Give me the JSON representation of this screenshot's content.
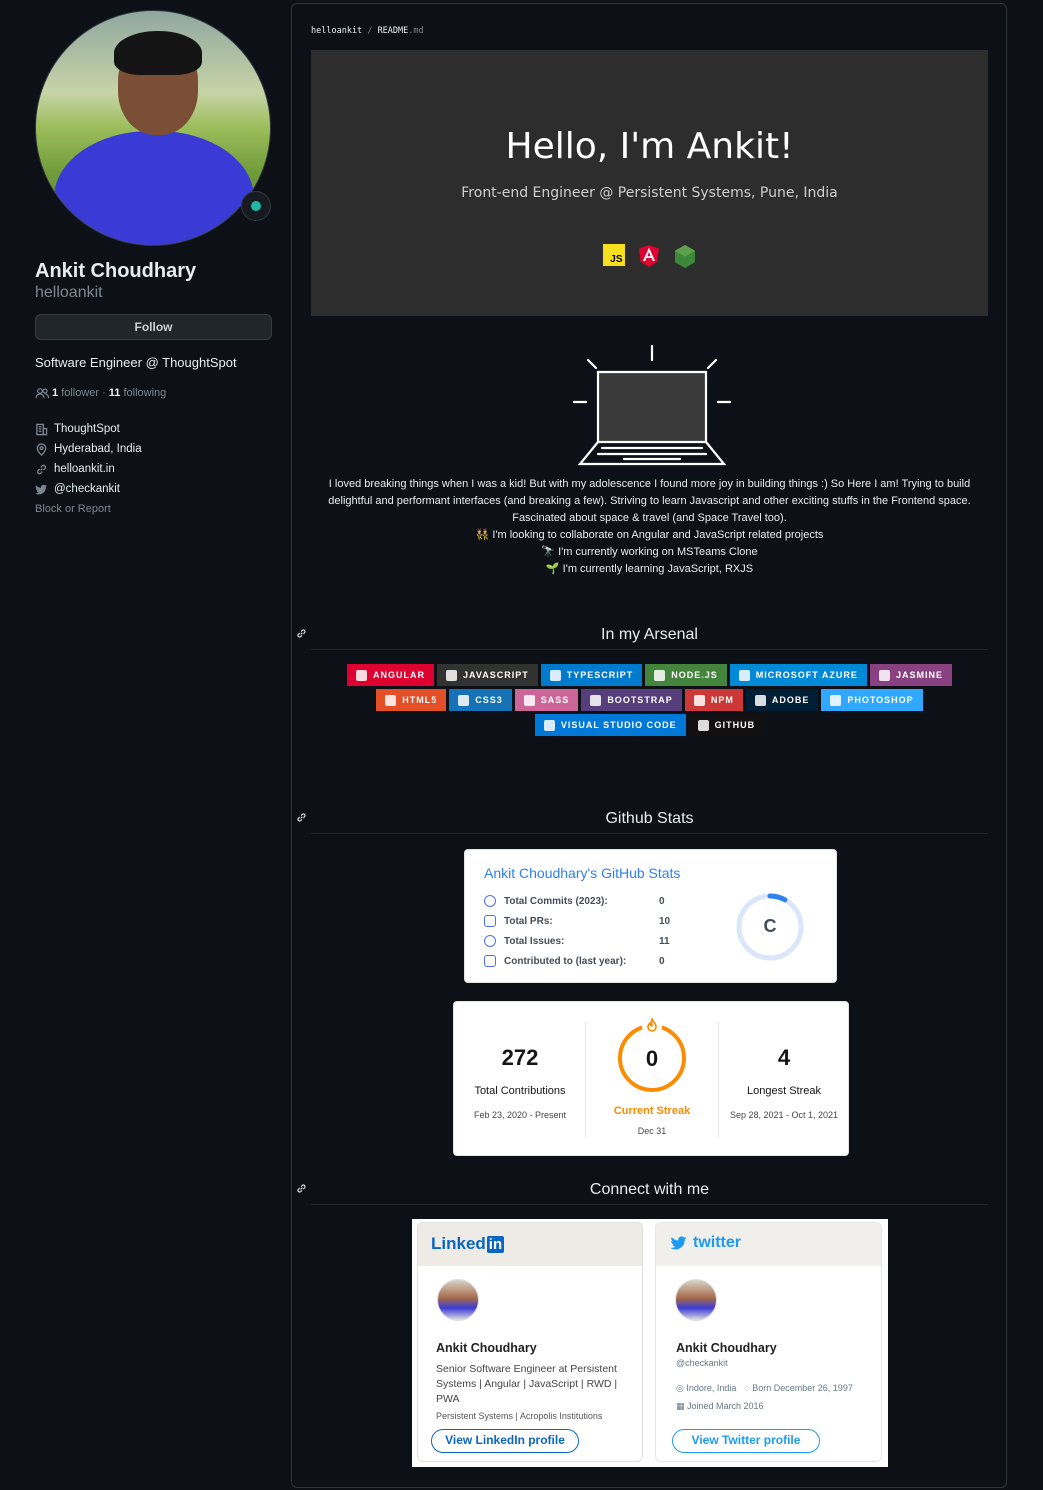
{
  "profile": {
    "name": "Ankit Choudhary",
    "login": "helloankit",
    "follow_label": "Follow",
    "bio": "Software Engineer @ ThoughtSpot",
    "followers_count": "1",
    "followers_label": "follower",
    "separator": "·",
    "following_count": "11",
    "following_label": "following",
    "company": "ThoughtSpot",
    "location": "Hyderabad, India",
    "website": "helloankit.in",
    "twitter": "@checkankit",
    "block_report": "Block or Report"
  },
  "breadcrumb": {
    "repo": "helloankit",
    "sep": "/",
    "file": "README",
    "ext": ".md"
  },
  "hero": {
    "title": "Hello, I'm Ankit!",
    "subtitle": "Front-end Engineer @ Persistent Systems, Pune, India",
    "icons": [
      "js-icon",
      "angular-icon",
      "nodejs-icon"
    ],
    "js_text": "JS"
  },
  "about": {
    "line1": "I loved breaking things when I was a kid! But with my adolescence I found more joy in building things :) So Here I am! Trying to build delightful and performant interfaces (and breaking a few). Striving to learn Javascript and other exciting stuffs in the Frontend space. Fascinated about space & travel (and Space Travel too).",
    "line2": "👯 I'm looking to collaborate on Angular and JavaScript related projects",
    "line3": "🔭 I'm currently working on MSTeams Clone",
    "line4": "🌱 I'm currently learning JavaScript, RXJS"
  },
  "sections": {
    "arsenal": "In my Arsenal",
    "stats": "Github Stats",
    "connect": "Connect with me"
  },
  "badges": [
    {
      "label": "Angular",
      "color": "#dd0031"
    },
    {
      "label": "JavaScript",
      "color": "#323330"
    },
    {
      "label": "TypeScript",
      "color": "#007acc"
    },
    {
      "label": "Node.js",
      "color": "#43853d"
    },
    {
      "label": "Microsoft Azure",
      "color": "#0089d6"
    },
    {
      "label": "Jasmine",
      "color": "#8a4182"
    },
    {
      "label": "HTML5",
      "color": "#e34f26"
    },
    {
      "label": "CSS3",
      "color": "#1572b6"
    },
    {
      "label": "SASS",
      "color": "#cc6699"
    },
    {
      "label": "Bootstrap",
      "color": "#563d7c"
    },
    {
      "label": "NPM",
      "color": "#cb3837"
    },
    {
      "label": "ADOBE",
      "color": "#001e36"
    },
    {
      "label": "PHOTOSHOP",
      "color": "#31a8ff"
    },
    {
      "label": "Visual Studio Code",
      "color": "#0078d7"
    },
    {
      "label": "GitHub",
      "color": "#121011"
    }
  ],
  "github_stats": {
    "title": "Ankit Choudhary's GitHub Stats",
    "rows": [
      {
        "label": "Total Commits (2023):",
        "value": "0"
      },
      {
        "label": "Total PRs:",
        "value": "10"
      },
      {
        "label": "Total Issues:",
        "value": "11"
      },
      {
        "label": "Contributed to (last year):",
        "value": "0"
      }
    ],
    "rank": "C",
    "rank_progress": 0.08
  },
  "streak": {
    "total": "272",
    "total_label": "Total Contributions",
    "total_range": "Feb 23, 2020 - Present",
    "current": "0",
    "current_label": "Current Streak",
    "current_range": "Dec 31",
    "longest": "4",
    "longest_label": "Longest Streak",
    "longest_range": "Sep 28, 2021 - Oct 1, 2021"
  },
  "linkedin": {
    "logo": "Linked",
    "logo_in": "in",
    "name": "Ankit Choudhary",
    "headline": "Senior Software Engineer at Persistent Systems | Angular | JavaScript | RWD | PWA",
    "orgs": "Persistent Systems | Acropolis Institutions",
    "button": "View LinkedIn profile"
  },
  "twitter": {
    "logo": "twitter",
    "name": "Ankit Choudhary",
    "handle": "@checkankit",
    "location": "Indore, India",
    "born": "Born December 26, 1997",
    "joined": "Joined March 2016",
    "button": "View Twitter profile"
  },
  "colors": {
    "bg": "#0d1117",
    "accent": "#2f80ed",
    "streak": "#fb8c00"
  }
}
